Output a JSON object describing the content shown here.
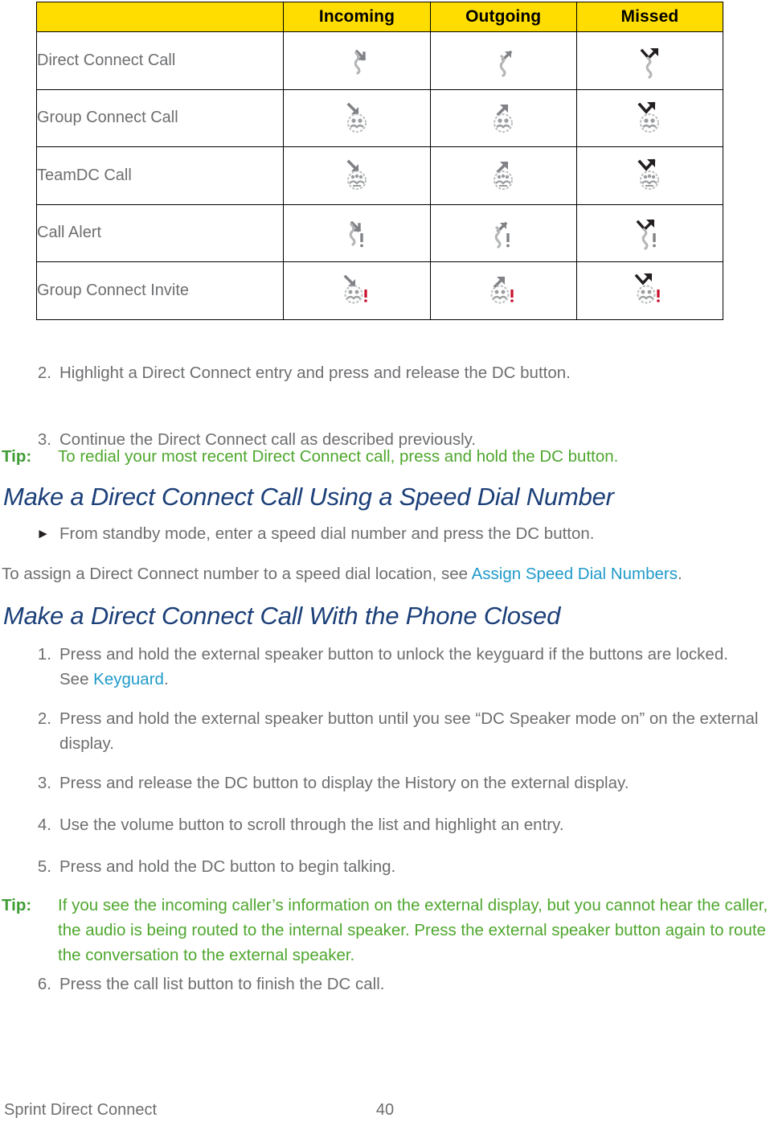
{
  "table": {
    "corner_header": "",
    "columns": [
      "Incoming",
      "Outgoing",
      "Missed"
    ],
    "header_bg": "#FFDD00",
    "rows": [
      {
        "label": "Direct Connect Call",
        "icons": [
          "dc-incoming-icon",
          "dc-outgoing-icon",
          "dc-missed-icon"
        ]
      },
      {
        "label": "Group Connect Call",
        "icons": [
          "group-incoming-icon",
          "group-outgoing-icon",
          "group-missed-icon"
        ]
      },
      {
        "label": "TeamDC Call",
        "icons": [
          "teamdc-incoming-icon",
          "teamdc-outgoing-icon",
          "teamdc-missed-icon"
        ]
      },
      {
        "label": "Call Alert",
        "icons": [
          "alert-incoming-icon",
          "alert-outgoing-icon",
          "alert-missed-icon"
        ]
      },
      {
        "label": "Group Connect Invite",
        "icons": [
          "invite-incoming-icon",
          "invite-outgoing-icon",
          "invite-missed-icon"
        ]
      }
    ]
  },
  "steps_top": [
    {
      "num": "2.",
      "text": "Highlight a Direct Connect entry and press and release the DC button."
    },
    {
      "num": "3.",
      "text": "Continue the Direct Connect call as described previously."
    }
  ],
  "tip1": {
    "label": "Tip:",
    "text": "To redial your most recent Direct Connect call, press and hold the DC button."
  },
  "heading1": "Make a Direct Connect Call Using a Speed Dial Number",
  "bullet1": {
    "marker": "►",
    "text": "From standby mode, enter a speed dial number and press the DC button."
  },
  "para1": {
    "before": "To assign a Direct Connect number to a speed dial location, see ",
    "link": "Assign Speed Dial Numbers",
    "after": "."
  },
  "heading2": "Make a Direct Connect Call With the Phone Closed",
  "steps_bottom_a": [
    {
      "num": "1.",
      "before": "Press and hold the external speaker button to unlock the keyguard if the buttons are locked. See ",
      "link": "Keyguard",
      "after": "."
    },
    {
      "num": "2.",
      "before": "Press and hold the external speaker button until you see “DC Speaker mode on” on the external display.",
      "link": "",
      "after": ""
    },
    {
      "num": "3.",
      "before": "Press and release the DC button to display the History on the external display.",
      "link": "",
      "after": ""
    },
    {
      "num": "4.",
      "before": "Use the volume button to scroll through the list and highlight an entry.",
      "link": "",
      "after": ""
    },
    {
      "num": "5.",
      "before": "Press and hold the DC button to begin talking.",
      "link": "",
      "after": ""
    }
  ],
  "tip2": {
    "label": "Tip:",
    "text": "If you see the incoming caller’s information on the external display, but you cannot hear the caller, the audio is being routed to the internal speaker. Press the external speaker button again to route the conversation to the external speaker."
  },
  "step_last": {
    "num": "6.",
    "text": "Press the call list button to finish the DC call."
  },
  "footer": {
    "section": "Sprint Direct Connect",
    "page": "40"
  },
  "colors": {
    "header_yellow": "#FFDD00",
    "body_gray": "#6d6e70",
    "heading_navy": "#1b3f78",
    "tip_green": "#4fa72e",
    "tip_label_green": "#3f9c35",
    "link_blue": "#1f9ac9",
    "missed_arrow": "#231f20",
    "normal_arrow": "#808285",
    "exclaim_red": "#c8102e"
  }
}
